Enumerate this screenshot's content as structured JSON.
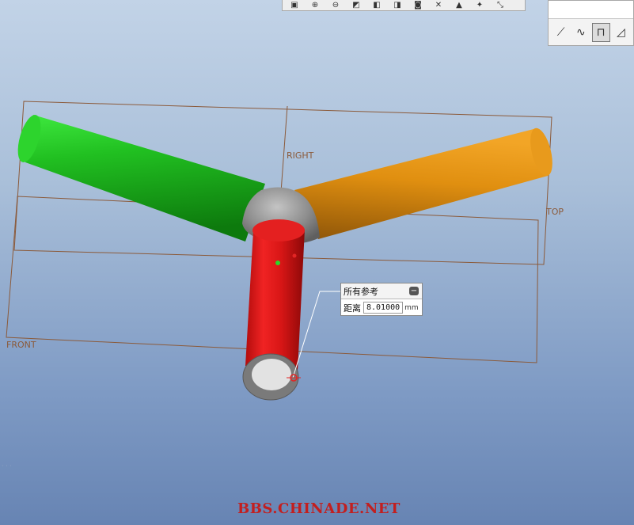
{
  "toolbar": {
    "icons": [
      "zoom-fit-icon",
      "zoom-in-icon",
      "zoom-out-icon",
      "repaint-icon",
      "orient-icon",
      "saved-views-icon",
      "camera-icon",
      "datum-axis-icon",
      "datum-plane-icon",
      "datum-point-icon",
      "csys-icon"
    ]
  },
  "sketch_tools": {
    "icons": [
      "ruler-icon",
      "curve-icon",
      "sketch-dims-icon",
      "triangle-icon"
    ],
    "active": "sketch-dims-icon"
  },
  "datum_labels": {
    "right": "RIGHT",
    "top": "TOP",
    "front": "FRONT"
  },
  "reference_panel": {
    "title": "所有参考",
    "distance_label": "距离",
    "distance_value": "8.01000",
    "unit": "mm"
  },
  "watermark": "BBS.CHINADE.NET",
  "colors": {
    "left_arm": "#1fb01f",
    "right_arm": "#dd8f10",
    "bottom_arm": "#e01818",
    "hub": "#8f8f8f",
    "datum": "#8b5a3a"
  }
}
